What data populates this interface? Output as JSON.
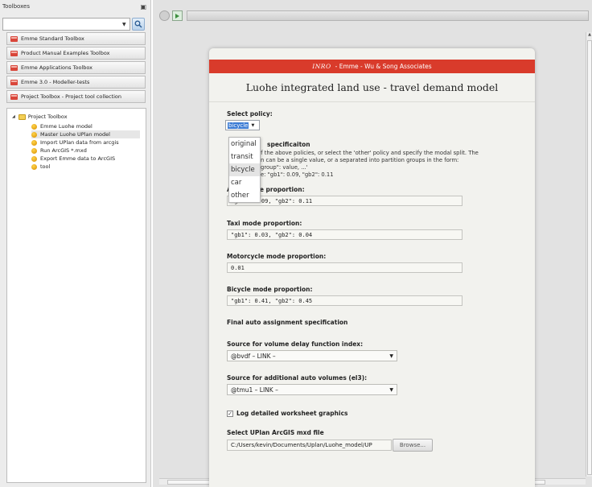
{
  "left_panel": {
    "title": "Toolboxes",
    "search": {
      "value": "",
      "placeholder": ""
    },
    "toolbox_tabs": [
      "Emme Standard Toolbox",
      "Product Manual Examples Toolbox",
      "Emme Applications Toolbox",
      "Emme 3.0 - Modeller-tests",
      "Project Toolbox - Project tool collection"
    ],
    "tree": {
      "root": "Project Toolbox",
      "items": [
        "Emme Luohe model",
        "Master Luohe UPlan model",
        "Import UPlan data from arcgis",
        "Run ArcGIS *.mxd",
        "Export Emme data to ArcGIS",
        "tool"
      ],
      "selected_index": 1
    }
  },
  "form": {
    "header": {
      "logo": "INRO",
      "text": "- Emme - Wu & Song Associates"
    },
    "title": "Luohe integrated land use - travel demand model",
    "select_policy": {
      "label": "Select policy:",
      "value": "bicycle",
      "options": [
        "original",
        "transit",
        "bicycle",
        "car",
        "other"
      ],
      "hovered_index": 2
    },
    "spec": {
      "label_start": "",
      "label_end": "specificaiton",
      "line1": "of the above policies, or select the 'other' policy and specify the modal split. The",
      "line2": "n can be a single value, or a separated into partition groups in the form:",
      "line3": "group\": value, ...'",
      "line4": "e: \"gb1\": 0.09, \"gb2\": 0.11"
    },
    "auto": {
      "label": "Auto mode proportion:",
      "value": "\"gb1\": 0.09, \"gb2\": 0.11"
    },
    "taxi": {
      "label": "Taxi mode proportion:",
      "value": "\"gb1\": 0.03, \"gb2\": 0.04"
    },
    "motorcycle": {
      "label": "Motorcycle mode proportion:",
      "value": "0.01"
    },
    "bicycle": {
      "label": "Bicycle mode proportion:",
      "value": "\"gb1\": 0.41, \"gb2\": 0.45"
    },
    "final_heading": "Final auto assignment specification",
    "vdf": {
      "label": "Source for volume delay function index:",
      "value": "@bvdf – LINK –"
    },
    "el3": {
      "label": "Source for additional auto volumes (el3):",
      "value": "@tmu1 – LINK –"
    },
    "log": {
      "label": "Log detailed worksheet graphics",
      "checked": true,
      "mark": "✓"
    },
    "mxd": {
      "label": "Select UPlan ArcGIS mxd file",
      "value": "C:/Users/kevin/Documents/Uplan/Luohe_model/UP",
      "browse": "Browse..."
    }
  },
  "colors": {
    "header_red": "#d93b2b",
    "accent_orange": "#ff6a1a",
    "accent_blue": "#2a8fd0",
    "selection_blue": "#3b7bd4"
  }
}
